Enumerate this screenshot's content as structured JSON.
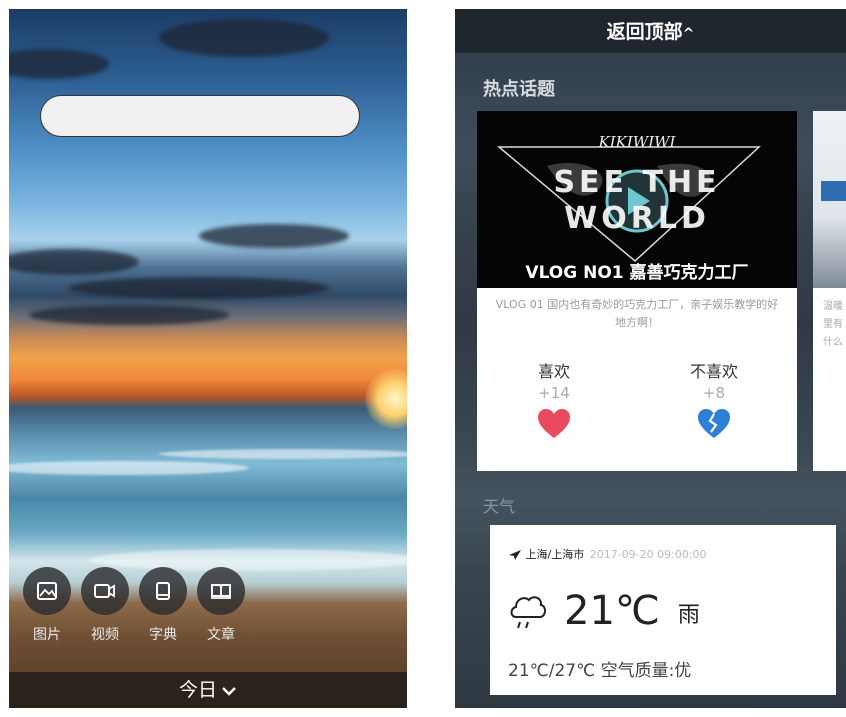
{
  "left": {
    "search": {
      "placeholder": ""
    },
    "quick_actions": [
      {
        "label": "图片",
        "icon": "image-icon"
      },
      {
        "label": "视频",
        "icon": "video-icon"
      },
      {
        "label": "字典",
        "icon": "dictionary-icon"
      },
      {
        "label": "文章",
        "icon": "article-icon"
      }
    ],
    "bottom_bar": {
      "label": "今日"
    }
  },
  "right": {
    "back_to_top": "返回顶部",
    "hot_topics_title": "热点话题",
    "topic_card": {
      "thumb_brand": "KIKIWIWI",
      "thumb_line1": "SEE THE",
      "thumb_line2": "WORLD",
      "thumb_caption": "VLOG NO1 嘉善巧克力工厂",
      "description": "VLOG 01 国内也有奇妙的巧克力工厂，亲子娱乐教学的好地方啊！",
      "like_label": "喜欢",
      "like_count": "+14",
      "dislike_label": "不喜欢",
      "dislike_count": "+8"
    },
    "second_card_partial": {
      "text_lines": [
        "温暖",
        "里有",
        "什么"
      ]
    },
    "weather_title": "天气",
    "weather": {
      "location": "上海/上海市",
      "datetime": "2017-09-20 09:00:00",
      "temperature": "21℃",
      "condition": "雨",
      "range_and_air": "21℃/27℃ 空气质量:优"
    }
  },
  "colors": {
    "like": "#e84a5f",
    "dislike": "#2f7fd6"
  }
}
